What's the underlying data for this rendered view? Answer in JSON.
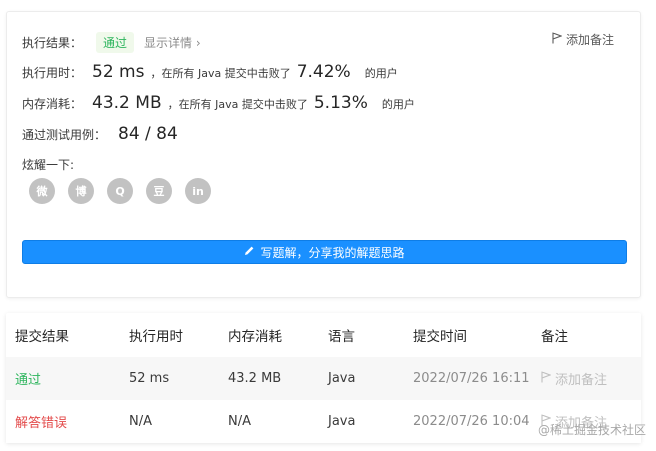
{
  "result": {
    "label_result": "执行结果：",
    "status": "通过",
    "detail_link": "显示详情",
    "detail_chevron": "›",
    "add_note": "添加备注",
    "runtime": {
      "label": "执行用时：",
      "value": "52 ms",
      "text_before": "，在所有 Java 提交中击败了",
      "percent": "7.42%",
      "text_after": "的用户"
    },
    "memory": {
      "label": "内存消耗：",
      "value": "43.2 MB",
      "text_before": "，在所有 Java 提交中击败了",
      "percent": "5.13%",
      "text_after": "的用户"
    },
    "tests": {
      "label": "通过测试用例：",
      "value": "84 / 84"
    },
    "share_label": "炫耀一下:",
    "share_icons": [
      "wechat-icon",
      "weibo-icon",
      "qq-icon",
      "douban-icon",
      "linkedin-icon"
    ],
    "share_glyphs": [
      "微",
      "博",
      "Q",
      "豆",
      "in"
    ],
    "write_button": "写题解，分享我的解题思路"
  },
  "submissions": {
    "headers": [
      "提交结果",
      "执行用时",
      "内存消耗",
      "语言",
      "提交时间",
      "备注"
    ],
    "rows": [
      {
        "result": "通过",
        "runtime": "52 ms",
        "memory": "43.2 MB",
        "language": "Java",
        "time": "2022/07/26 16:11",
        "note": "添加备注"
      },
      {
        "result": "解答错误",
        "runtime": "N/A",
        "memory": "N/A",
        "language": "Java",
        "time": "2022/07/26 10:04",
        "note": "添加备注"
      }
    ]
  },
  "watermark": "@稀土掘金技术社区",
  "colors": {
    "accent": "#1a90ff",
    "success": "#2db55d",
    "error": "#e34b4b",
    "icon_grey": "#c2c2c2"
  }
}
